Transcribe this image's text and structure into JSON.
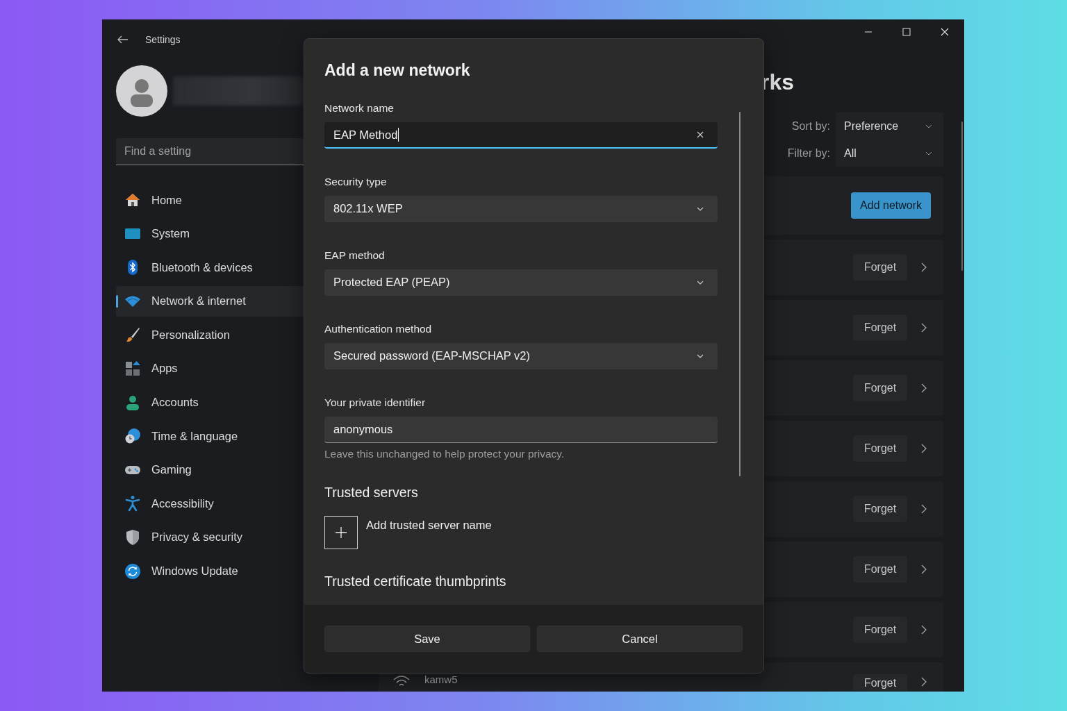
{
  "window": {
    "title": "Settings"
  },
  "sidebar": {
    "search": {
      "placeholder": "Find a setting"
    },
    "items": [
      {
        "label": "Home",
        "selected": false
      },
      {
        "label": "System",
        "selected": false
      },
      {
        "label": "Bluetooth & devices",
        "selected": false
      },
      {
        "label": "Network & internet",
        "selected": true
      },
      {
        "label": "Personalization",
        "selected": false
      },
      {
        "label": "Apps",
        "selected": false
      },
      {
        "label": "Accounts",
        "selected": false
      },
      {
        "label": "Time & language",
        "selected": false
      },
      {
        "label": "Gaming",
        "selected": false
      },
      {
        "label": "Accessibility",
        "selected": false
      },
      {
        "label": "Privacy & security",
        "selected": false
      },
      {
        "label": "Windows Update",
        "selected": false
      }
    ]
  },
  "page": {
    "title": "rks",
    "sort": {
      "label": "Sort by:",
      "value": "Preference"
    },
    "filter": {
      "label": "Filter by:",
      "value": "All"
    },
    "add_button": "Add network",
    "networks": [
      {
        "forget": "Forget"
      },
      {
        "forget": "Forget"
      },
      {
        "forget": "Forget"
      },
      {
        "forget": "Forget"
      },
      {
        "forget": "Forget"
      },
      {
        "forget": "Forget"
      },
      {
        "forget": "Forget"
      },
      {
        "name": "kamw5",
        "forget": "Forget"
      }
    ]
  },
  "dialog": {
    "title": "Add a new network",
    "fields": [
      {
        "kind": "text",
        "label": "Network name",
        "value": "EAP Method",
        "focused": true
      },
      {
        "kind": "dropdown",
        "label": "Security type",
        "value": "802.11x WEP"
      },
      {
        "kind": "dropdown",
        "label": "EAP method",
        "value": "Protected EAP (PEAP)"
      },
      {
        "kind": "dropdown",
        "label": "Authentication method",
        "value": "Secured password (EAP-MSCHAP v2)"
      },
      {
        "kind": "text",
        "label": "Your private identifier",
        "value": "anonymous",
        "focused": false,
        "help": "Leave this unchanged to help protect your privacy."
      }
    ],
    "trusted_servers": {
      "heading": "Trusted servers",
      "add_label": "Add trusted server name"
    },
    "next_heading": "Trusted certificate thumbprints",
    "buttons": [
      "Save",
      "Cancel"
    ]
  }
}
